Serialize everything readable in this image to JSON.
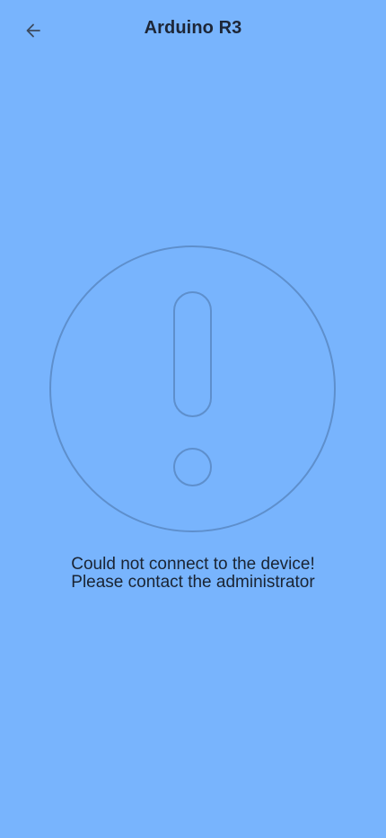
{
  "header": {
    "title": "Arduino R3",
    "back_icon": "arrow-left-icon"
  },
  "error": {
    "icon": "exclamation-circle-icon",
    "line1": "Could not connect to the device!",
    "line2": "Please contact the administrator"
  },
  "colors": {
    "background": "#78b4fd",
    "title_text": "#1d2637",
    "icon_stroke": "#5e8fcc",
    "message_text": "#1a2433"
  }
}
